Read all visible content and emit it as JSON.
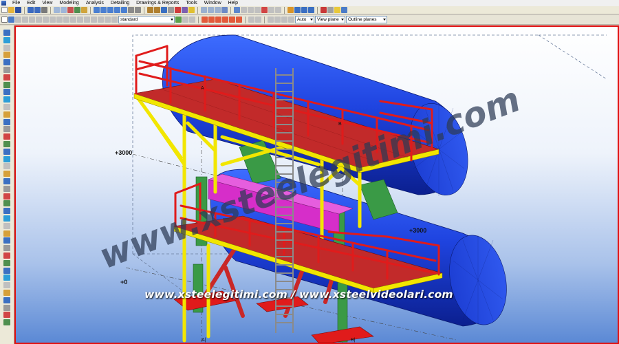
{
  "menu": [
    "File",
    "Edit",
    "View",
    "Modeling",
    "Analysis",
    "Detailing",
    "Drawings & Reports",
    "Tools",
    "Window",
    "Help"
  ],
  "toolbar": {
    "filter_value": "standard",
    "mode_value": "Auto",
    "plane_value": "View plane",
    "outline_value": "Outline planes"
  },
  "viewport": {
    "elevation_top": "+3000",
    "elevation_right": "+3000",
    "elevation_bottom": "+0",
    "grid_a": "A",
    "grid_b": "B",
    "grid_a_bottom": "A|",
    "grid_b_bottom": "B|"
  },
  "watermark": {
    "diagonal": "www.xsteelegitimi.com",
    "footer": "www.xsteelegitimi.com / www.xsteelvideolari.com"
  },
  "colors": {
    "tank": "#1f44e0",
    "frame": "#f2e600",
    "handrail": "#e01b1b",
    "viewport_border": "#e01010",
    "brace": "#d63a3a",
    "bracket": "#3a9a46",
    "beam": "#d62ec9",
    "ladder": "#8a8a8a"
  }
}
